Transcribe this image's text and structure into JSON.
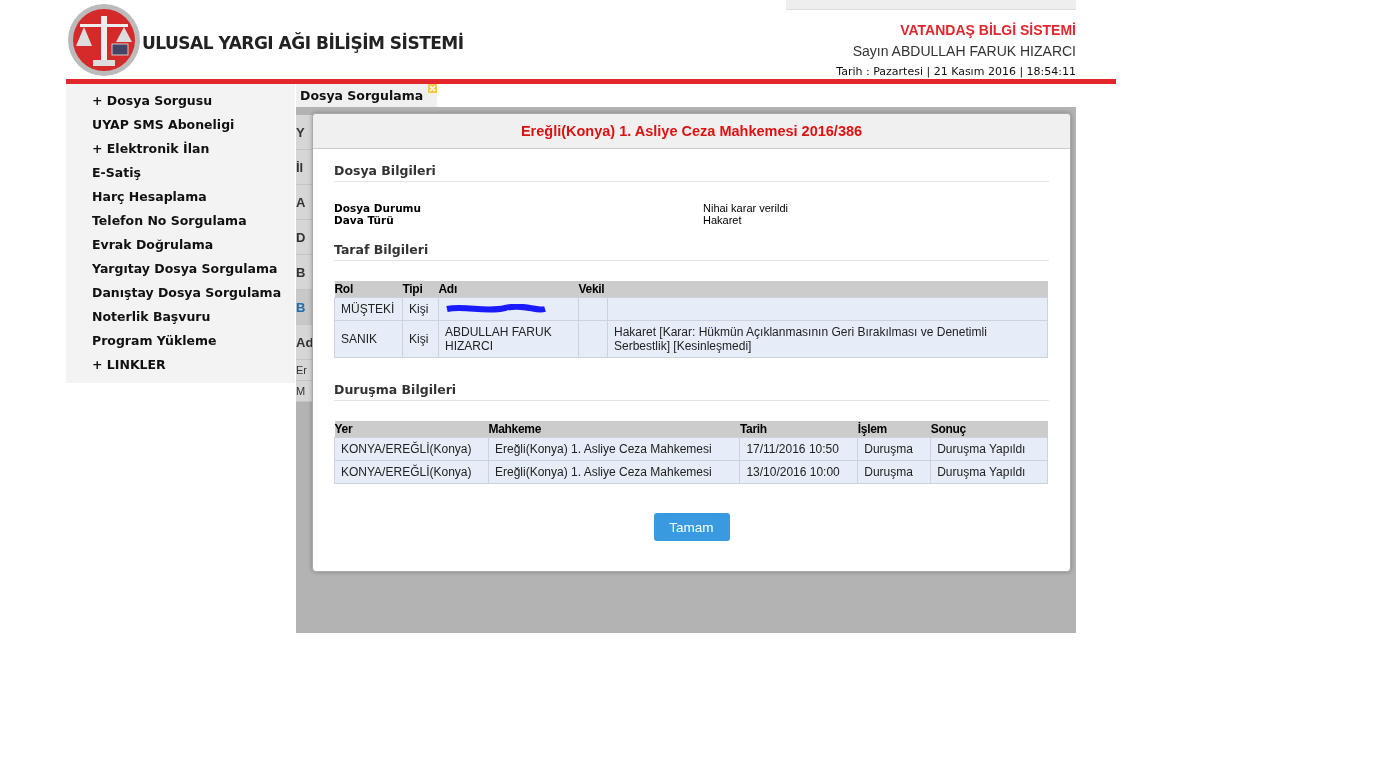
{
  "header": {
    "site_title": "ULUSAL YARGI AĞI BİLİŞİM SİSTEMİ",
    "system_title": "VATANDAŞ BİLGİ SİSTEMİ",
    "user_greeting": "Sayın ABDULLAH FARUK HIZARCI",
    "date_line": "Tarih : Pazartesi | 21 Kasım 2016 | 18:54:11"
  },
  "sidebar": {
    "items": [
      {
        "label": "+ Dosya Sorgusu"
      },
      {
        "label": "UYAP SMS Aboneligi"
      },
      {
        "label": "+ Elektronik İlan"
      },
      {
        "label": "E-Satiş"
      },
      {
        "label": "Harç Hesaplama"
      },
      {
        "label": "Telefon No Sorgulama"
      },
      {
        "label": "Evrak Doğrulama"
      },
      {
        "label": "Yargıtay Dosya Sorgulama"
      },
      {
        "label": "Danıştay Dosya Sorgulama"
      },
      {
        "label": "Noterlik Başvuru"
      },
      {
        "label": "Program Yükleme"
      },
      {
        "label": "+ LINKLER"
      }
    ]
  },
  "tabs": [
    {
      "label": "Dosya Sorgulama",
      "selected": true
    }
  ],
  "background_fragments": [
    "Y",
    "İl",
    "A",
    "D",
    "B",
    "B",
    "Ad",
    "Er",
    "M"
  ],
  "dialog": {
    "title": "Ereğli(Konya) 1. Asliye Ceza Mahkemesi 2016/386",
    "file_section": {
      "heading": "Dosya Bilgileri",
      "fields": [
        {
          "label": "Dosya Durumu",
          "value": "Nihai karar verildi"
        },
        {
          "label": "Dava Türü",
          "value": "Hakaret"
        }
      ]
    },
    "party_section": {
      "heading": "Taraf Bilgileri",
      "columns": [
        "Rol",
        "Tipi",
        "Adı",
        "Vekil"
      ],
      "rows": [
        {
          "cells": [
            "MÜŞTEKİ",
            "Kişi",
            "",
            ""
          ],
          "redacted": true,
          "column_5": ""
        },
        {
          "cells": [
            "SANIK",
            "Kişi",
            "ABDULLAH FARUK HIZARCI",
            ""
          ],
          "redacted": false,
          "column_5": "Hakaret [Karar: Hükmün Açıklanmasının Geri Bırakılması ve Denetimli Serbestlik] [Kesinleşmedi]"
        }
      ]
    },
    "hearing_section": {
      "heading": "Duruşma Bilgileri",
      "columns": [
        "Yer",
        "Mahkeme",
        "Tarih",
        "İşlem",
        "Sonuç"
      ],
      "rows": [
        [
          "KONYA/EREĞLİ(Konya)",
          "Ereğli(Konya) 1. Asliye Ceza Mahkemesi",
          "17/11/2016 10:50",
          "Duruşma",
          "Duruşma Yapıldı"
        ],
        [
          "KONYA/EREĞLİ(Konya)",
          "Ereğli(Konya) 1. Asliye Ceza Mahkemesi",
          "13/10/2016 10:00",
          "Duruşma",
          "Duruşma Yapıldı"
        ]
      ]
    },
    "ok_button": "Tamam"
  }
}
